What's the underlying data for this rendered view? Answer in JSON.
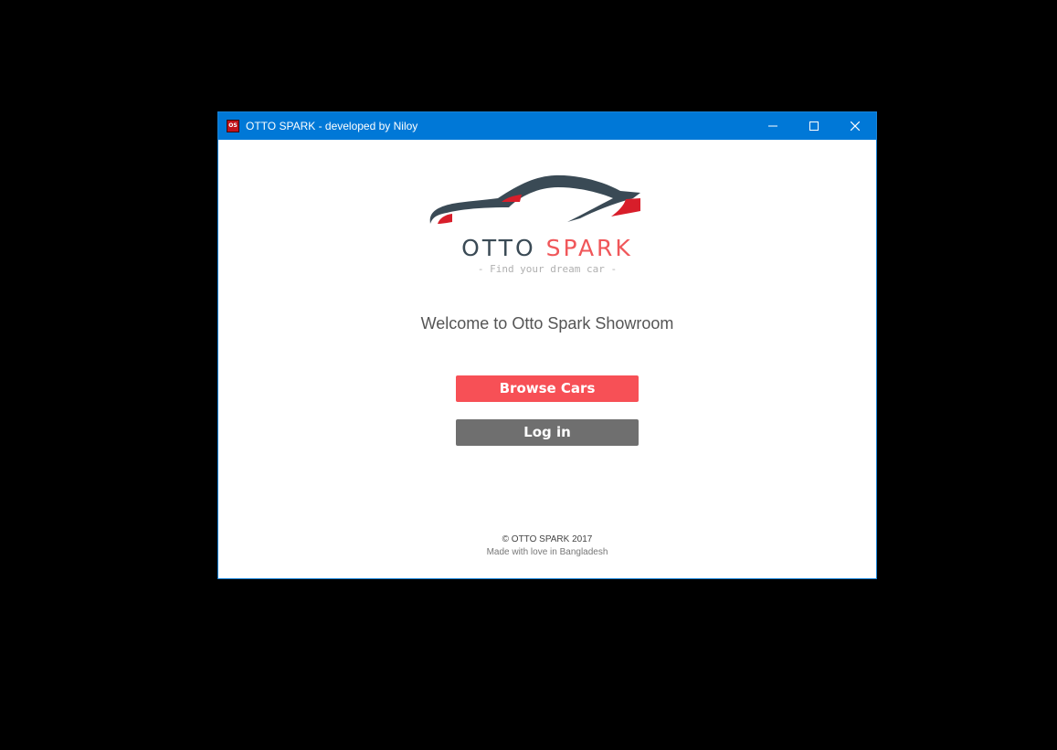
{
  "window": {
    "title": "OTTO SPARK - developed by Niloy",
    "icon_text": "OS",
    "controls": {
      "minimize": "minimize-icon",
      "maximize": "maximize-icon",
      "close": "close-icon"
    },
    "titlebar_color": "#0078d7"
  },
  "logo": {
    "word_1": "OTTO",
    "word_2": "SPARK",
    "tagline": "- Find your dream car -",
    "colors": {
      "dark": "#3a4a55",
      "accent": "#f0575a"
    }
  },
  "main": {
    "welcome": "Welcome to Otto Spark Showroom",
    "browse_label": "Browse Cars",
    "login_label": "Log in",
    "browse_color": "#f75056",
    "login_color": "#6f6f6f"
  },
  "footer": {
    "copyright": "© OTTO SPARK 2017",
    "credit": "Made with love in Bangladesh"
  }
}
